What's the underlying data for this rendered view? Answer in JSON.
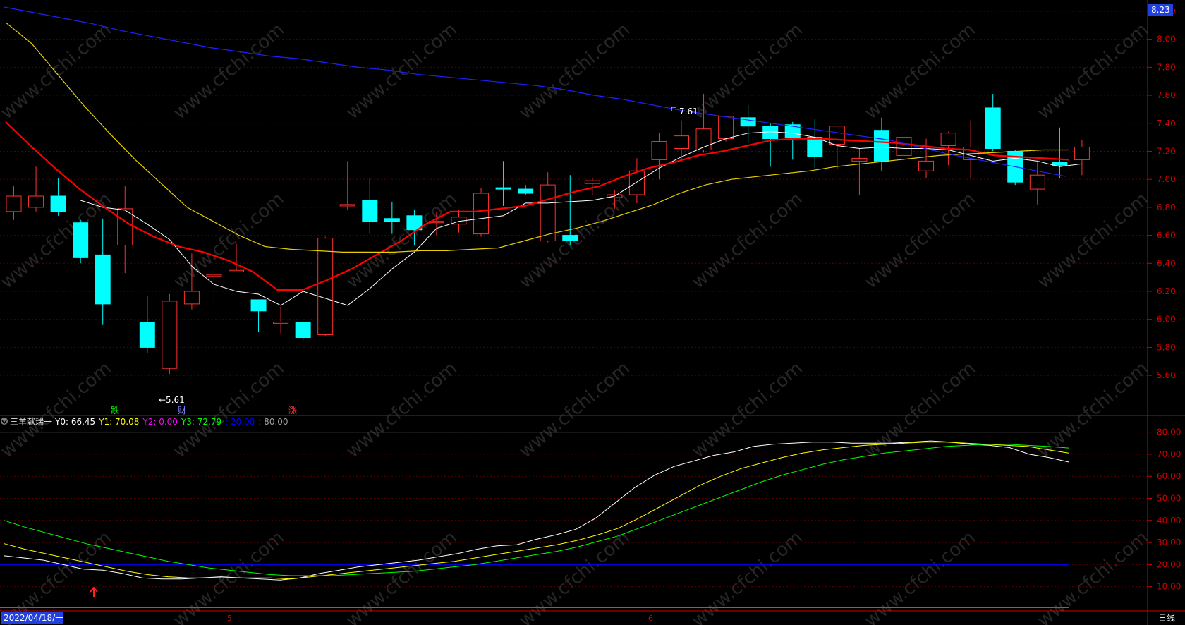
{
  "price_axis": {
    "current_price": "8.23",
    "ticks": [
      "8.20",
      "8.00",
      "7.80",
      "7.60",
      "7.40",
      "7.20",
      "7.00",
      "6.80",
      "6.60",
      "6.40",
      "6.20",
      "6.00",
      "5.80",
      "5.60"
    ]
  },
  "annotations": {
    "high_label": "7.61",
    "low_label": "←5.61",
    "markers": [
      {
        "text": "跌",
        "color": "#00ff00"
      },
      {
        "text": "财",
        "color": "#8080ff"
      },
      {
        "text": "涨",
        "color": "#ff3030"
      }
    ]
  },
  "indicator": {
    "name": "三羊献瑞一",
    "values": [
      {
        "label": "Y0:",
        "value": "66.45",
        "color": "#ffffff"
      },
      {
        "label": "Y1:",
        "value": "70.08",
        "color": "#ffff00"
      },
      {
        "label": "Y2:",
        "value": "0.00",
        "color": "#ff00ff"
      },
      {
        "label": "Y3:",
        "value": "72.79",
        "color": "#00ff00"
      },
      {
        "label": ":",
        "value": "20.00",
        "color": "#0000ff"
      },
      {
        "label": ":",
        "value": "80.00",
        "color": "#a0a0a0"
      }
    ],
    "ticks": [
      "80.00",
      "70.00",
      "60.00",
      "50.00",
      "40.00",
      "30.00",
      "20.00",
      "10.00"
    ]
  },
  "date_axis": {
    "start_date": "2022/04/18/一",
    "months": [
      "5",
      "6"
    ],
    "period_button": "日线"
  },
  "watermark": "www.cfchi.com",
  "colors": {
    "up": "#ff3030",
    "down": "#00ffff",
    "ma5": "#ffffff",
    "ma10": "#ff0000",
    "ma20": "#e8d000",
    "ma60": "#2020ff",
    "axis": "#d00000"
  },
  "chart_data": [
    {
      "type": "candlestick",
      "ylim": [
        5.52,
        8.24
      ],
      "x": [
        "2022-04-18",
        "2022-04-19",
        "2022-04-20",
        "2022-04-21",
        "2022-04-22",
        "2022-04-25",
        "2022-04-26",
        "2022-04-27",
        "2022-04-28",
        "2022-04-29",
        "2022-05-05",
        "2022-05-06",
        "2022-05-09",
        "2022-05-10",
        "2022-05-11",
        "2022-05-12",
        "2022-05-13",
        "2022-05-16",
        "2022-05-17",
        "2022-05-18",
        "2022-05-19",
        "2022-05-20",
        "2022-05-23",
        "2022-05-24",
        "2022-05-25",
        "2022-05-26",
        "2022-05-27",
        "2022-05-30",
        "2022-05-31",
        "2022-06-01",
        "2022-06-02",
        "2022-06-06",
        "2022-06-07",
        "2022-06-08",
        "2022-06-09",
        "2022-06-10",
        "2022-06-13",
        "2022-06-14",
        "2022-06-15",
        "2022-06-16",
        "2022-06-17",
        "2022-06-20",
        "2022-06-21",
        "2022-06-22",
        "2022-06-23",
        "2022-06-24",
        "2022-06-27",
        "2022-06-28",
        "2022-06-29"
      ],
      "open": [
        6.77,
        6.8,
        6.88,
        6.69,
        6.46,
        6.53,
        5.98,
        5.65,
        6.11,
        6.31,
        6.34,
        6.14,
        5.97,
        5.98,
        5.89,
        6.82,
        6.85,
        6.72,
        6.74,
        6.69,
        6.68,
        6.61,
        6.94,
        6.93,
        6.56,
        6.6,
        6.97,
        6.87,
        6.89,
        7.14,
        7.22,
        7.21,
        7.29,
        7.44,
        7.38,
        7.39,
        7.3,
        7.25,
        7.13,
        7.35,
        7.17,
        7.06,
        7.24,
        7.14,
        7.51,
        7.2,
        6.93,
        7.12,
        7.14
      ],
      "close": [
        6.88,
        6.88,
        6.77,
        6.44,
        6.11,
        6.79,
        5.8,
        6.13,
        6.2,
        6.32,
        6.35,
        6.06,
        5.98,
        5.87,
        6.58,
        6.82,
        6.7,
        6.7,
        6.64,
        6.7,
        6.73,
        6.9,
        6.93,
        6.9,
        6.96,
        6.56,
        6.99,
        6.89,
        7.06,
        7.27,
        7.31,
        7.36,
        7.45,
        7.38,
        7.29,
        7.3,
        7.16,
        7.38,
        7.15,
        7.13,
        7.3,
        7.13,
        7.33,
        7.23,
        7.22,
        6.98,
        7.03,
        7.1,
        7.23
      ],
      "high": [
        6.95,
        7.09,
        7.01,
        6.71,
        6.72,
        6.95,
        6.17,
        6.18,
        6.47,
        6.37,
        6.54,
        6.14,
        6.09,
        5.9,
        6.59,
        7.13,
        7.01,
        6.84,
        6.78,
        6.77,
        6.78,
        6.94,
        7.13,
        6.96,
        7.05,
        7.03,
        7.01,
        6.92,
        7.15,
        7.33,
        7.42,
        7.61,
        7.45,
        7.53,
        7.4,
        7.41,
        7.43,
        7.38,
        7.22,
        7.44,
        7.38,
        7.29,
        7.34,
        7.42,
        7.61,
        7.21,
        7.12,
        7.37,
        7.28
      ],
      "low": [
        6.71,
        6.77,
        6.74,
        6.4,
        5.96,
        6.33,
        5.76,
        5.61,
        6.07,
        6.1,
        6.34,
        5.91,
        5.9,
        5.85,
        5.88,
        6.78,
        6.61,
        6.61,
        6.53,
        6.6,
        6.62,
        6.59,
        6.81,
        6.89,
        6.55,
        6.53,
        6.89,
        6.79,
        6.83,
        7.0,
        7.12,
        7.19,
        7.27,
        7.26,
        7.09,
        7.14,
        7.08,
        7.07,
        6.89,
        7.06,
        7.14,
        7.01,
        7.1,
        7.01,
        7.2,
        6.96,
        6.82,
        7.01,
        7.03
      ],
      "series": [
        {
          "name": "MA5",
          "values": [
            6.85,
            6.8,
            6.78,
            6.68,
            6.57,
            6.38,
            6.25,
            6.2,
            6.18,
            6.1,
            6.2,
            6.15,
            6.1,
            6.22,
            6.36,
            6.48,
            6.65,
            6.7,
            6.72,
            6.74,
            6.83,
            6.83,
            6.84,
            6.85,
            6.88,
            6.98,
            7.08,
            7.16,
            7.23,
            7.29,
            7.33,
            7.34,
            7.33,
            7.3,
            7.24,
            7.22,
            7.23,
            7.22,
            7.22,
            7.21,
            7.17,
            7.13,
            7.15,
            7.13,
            7.09,
            7.11
          ]
        },
        {
          "name": "MA10",
          "values": [
            7.41,
            7.24,
            7.08,
            6.93,
            6.8,
            6.68,
            6.59,
            6.52,
            6.48,
            6.42,
            6.34,
            6.21,
            6.21,
            6.28,
            6.36,
            6.46,
            6.56,
            6.68,
            6.77,
            6.77,
            6.79,
            6.81,
            6.86,
            6.91,
            6.95,
            7.02,
            7.08,
            7.12,
            7.17,
            7.2,
            7.24,
            7.28,
            7.29,
            7.29,
            7.28,
            7.27,
            7.26,
            7.24,
            7.22,
            7.21,
            7.17,
            7.16,
            7.15,
            7.14
          ]
        },
        {
          "name": "MA20",
          "values": [
            8.12,
            7.97,
            7.75,
            7.53,
            7.33,
            7.14,
            6.97,
            6.8,
            6.7,
            6.6,
            6.52,
            6.5,
            6.49,
            6.48,
            6.48,
            6.48,
            6.49,
            6.49,
            6.5,
            6.51,
            6.56,
            6.61,
            6.65,
            6.7,
            6.76,
            6.82,
            6.9,
            6.96,
            7.0,
            7.02,
            7.04,
            7.06,
            7.09,
            7.11,
            7.13,
            7.15,
            7.17,
            7.18,
            7.19,
            7.2,
            7.21,
            7.21
          ]
        },
        {
          "name": "MA60",
          "values": [
            8.23,
            8.19,
            8.15,
            8.11,
            8.06,
            8.02,
            7.98,
            7.94,
            7.91,
            7.88,
            7.86,
            7.83,
            7.8,
            7.78,
            7.75,
            7.73,
            7.71,
            7.69,
            7.67,
            7.64,
            7.6,
            7.57,
            7.53,
            7.49,
            7.46,
            7.43,
            7.4,
            7.37,
            7.34,
            7.31,
            7.28,
            7.23,
            7.18,
            7.14,
            7.1,
            7.06,
            7.02
          ]
        }
      ]
    },
    {
      "type": "line",
      "title": "三羊献瑞一",
      "ylim": [
        0,
        83
      ],
      "series": [
        {
          "name": "Y0",
          "values": [
            24.0,
            23.0,
            22.0,
            20.0,
            18.0,
            17.5,
            16.0,
            14.0,
            13.5,
            13.5,
            14.0,
            14.5,
            14.0,
            13.5,
            13.0,
            14.0,
            16.0,
            17.5,
            19.0,
            20.0,
            21.0,
            22.0,
            23.5,
            25.0,
            27.0,
            28.5,
            29.0,
            31.5,
            33.5,
            36.0,
            41.0,
            48.0,
            55.0,
            60.5,
            64.5,
            67.0,
            69.5,
            71.0,
            73.5,
            74.5,
            75.0,
            75.5,
            75.5,
            75.0,
            75.0,
            75.0,
            75.5,
            76.0,
            75.5,
            74.5,
            74.0,
            73.0,
            70.0,
            68.5,
            66.5
          ]
        },
        {
          "name": "Y1",
          "values": [
            29.5,
            27.0,
            25.0,
            23.0,
            21.0,
            19.0,
            17.0,
            15.5,
            14.5,
            14.0,
            14.0,
            14.0,
            14.0,
            14.0,
            13.5,
            14.5,
            15.5,
            16.5,
            17.5,
            18.5,
            19.5,
            20.5,
            21.5,
            23.0,
            24.5,
            26.0,
            27.5,
            29.0,
            31.0,
            33.5,
            36.5,
            41.0,
            46.0,
            51.0,
            56.0,
            60.0,
            63.5,
            66.0,
            68.5,
            70.5,
            72.0,
            73.0,
            74.0,
            74.5,
            75.0,
            75.5,
            75.5,
            75.0,
            74.5,
            74.0,
            73.5,
            72.0,
            70.5
          ]
        },
        {
          "name": "Y3",
          "values": [
            40.0,
            37.0,
            34.5,
            32.0,
            29.5,
            27.5,
            25.5,
            23.5,
            21.5,
            20.0,
            18.5,
            17.5,
            16.5,
            15.5,
            15.0,
            15.0,
            15.0,
            15.5,
            16.0,
            16.5,
            17.0,
            18.0,
            19.0,
            20.0,
            21.5,
            23.0,
            24.5,
            26.0,
            28.0,
            30.5,
            33.0,
            36.5,
            40.0,
            43.5,
            47.0,
            50.5,
            54.0,
            57.5,
            60.5,
            63.0,
            65.5,
            67.5,
            69.0,
            70.5,
            71.5,
            72.5,
            73.5,
            74.0,
            74.5,
            74.5,
            74.0,
            73.5,
            72.8
          ]
        },
        {
          "name": "Y2",
          "values": [
            0,
            0
          ]
        }
      ]
    }
  ]
}
